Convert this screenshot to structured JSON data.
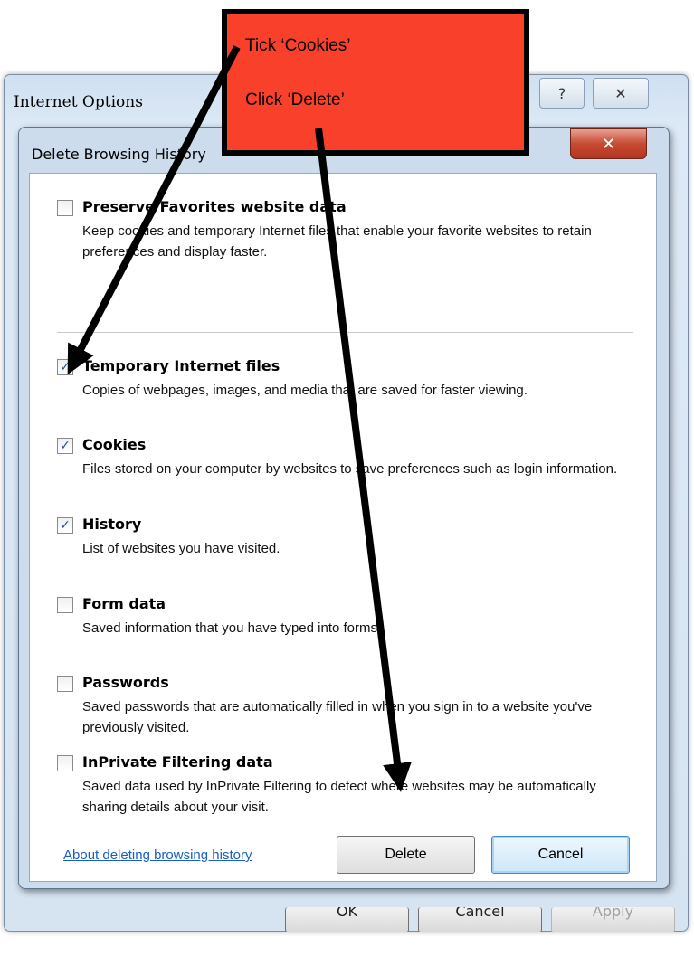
{
  "outer_window": {
    "title": "Internet Options",
    "help_glyph": "?",
    "close_glyph": "✕",
    "buttons": [
      "OK",
      "Cancel",
      "Apply"
    ]
  },
  "dialog": {
    "title": "Delete Browsing History",
    "close_glyph": "✕",
    "options": [
      {
        "label": "Preserve Favorites website data",
        "description": "Keep cookies and temporary Internet files that enable your favorite websites to retain preferences and display faster.",
        "checked": false
      },
      {
        "label": "Temporary Internet files",
        "description": "Copies of webpages, images, and media that are saved for faster viewing.",
        "checked": true
      },
      {
        "label": "Cookies",
        "description": "Files stored on your computer by websites to save preferences such as login information.",
        "checked": true
      },
      {
        "label": "History",
        "description": "List of websites you have visited.",
        "checked": true
      },
      {
        "label": "Form data",
        "description": "Saved information that you have typed into forms.",
        "checked": false
      },
      {
        "label": "Passwords",
        "description": "Saved passwords that are automatically filled in when you sign in to a website you've previously visited.",
        "checked": false
      },
      {
        "label": "InPrivate Filtering data",
        "description": "Saved data used by InPrivate Filtering to detect where websites may be automatically sharing details about your visit.",
        "checked": false
      }
    ],
    "about_link": "About deleting browsing history",
    "delete_label": "Delete",
    "cancel_label": "Cancel"
  },
  "annotation": {
    "line1": "Tick ‘Cookies’",
    "line2": "Click ‘Delete’",
    "box_color": "#f9402a"
  },
  "colors": {
    "link": "#1a5fbf",
    "check": "#2a4f96",
    "close_button": "#c74a32"
  }
}
